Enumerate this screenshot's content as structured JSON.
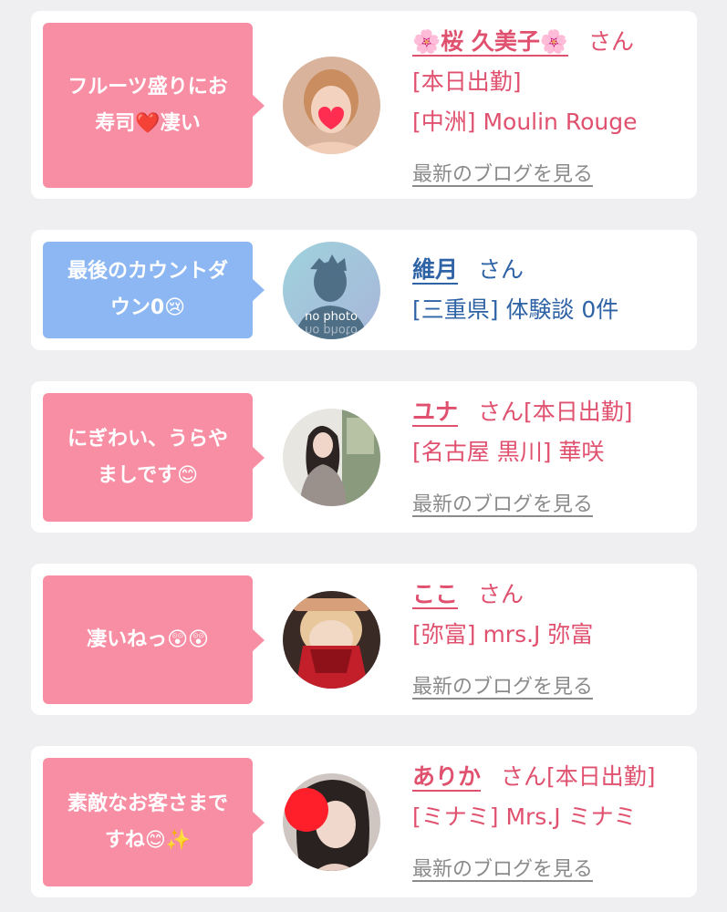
{
  "cards": [
    {
      "bubble": "フルーツ盛りにお\n寿司❤️凄い",
      "bubble_color": "#f88ea4",
      "avatar": "photo",
      "name": "🌸桜 久美子🌸",
      "san": "さん",
      "line1": "[本日出勤]",
      "line2": "[中洲] Moulin Rouge",
      "blog": "最新のブログを見る"
    },
    {
      "bubble": "最後のカウントダ\nウン0😢",
      "bubble_color": "#8db7f2",
      "avatar": "no-photo",
      "avatar_text": "no photo",
      "name": "維月",
      "san": "さん",
      "line1": "[三重県] 体験談 0件"
    },
    {
      "bubble": "にぎわい、うらや\nましです😊",
      "bubble_color": "#f88ea4",
      "avatar": "photo",
      "name": "ユナ",
      "san": "さん[本日出勤]",
      "line1": "[名古屋 黒川] 華咲",
      "blog": "最新のブログを見る"
    },
    {
      "bubble": "凄いねっ😲😲",
      "bubble_color": "#f88ea4",
      "avatar": "photo",
      "name": "ここ",
      "san": "さん",
      "line1": "[弥富] mrs.J 弥富",
      "blog": "最新のブログを見る"
    },
    {
      "bubble": "素敵なお客さまで\nすね😊✨",
      "bubble_color": "#f88ea4",
      "avatar": "photo",
      "name": "ありか",
      "san": "さん[本日出勤]",
      "line1": "[ミナミ] Mrs.J ミナミ",
      "blog": "最新のブログを見る"
    }
  ]
}
